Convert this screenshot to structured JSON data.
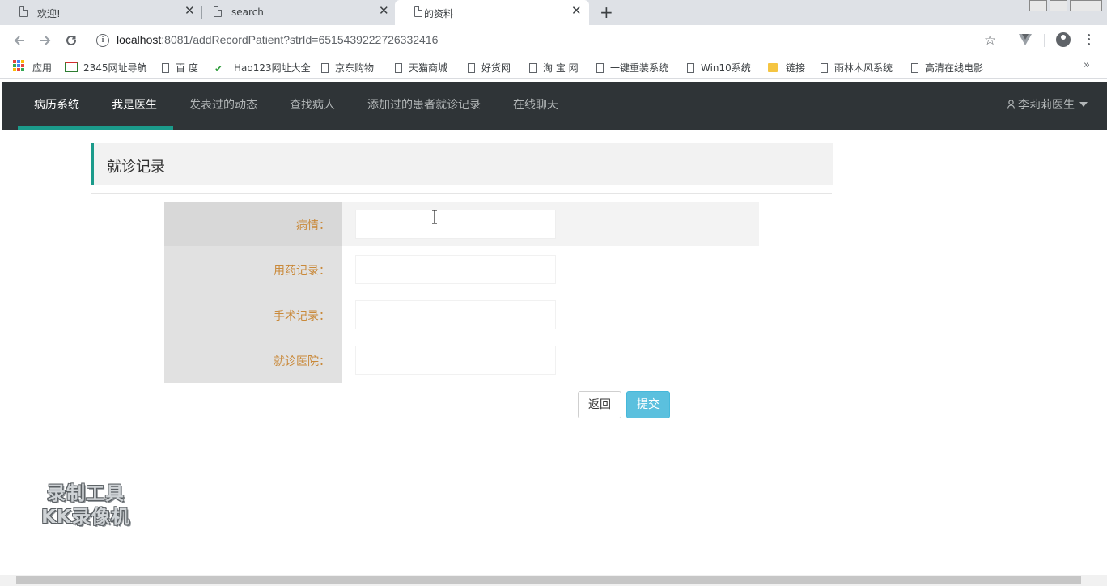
{
  "browser": {
    "tabs": [
      {
        "title": "欢迎!",
        "active": false
      },
      {
        "title": "search",
        "active": false
      },
      {
        "title": "的资料",
        "active": true
      }
    ],
    "url_host": "localhost",
    "url_rest": ":8081/addRecordPatient?strId=6515439222726332416",
    "bookmarks": [
      "应用",
      "2345网址导航",
      "百 度",
      "Hao123网址大全",
      "京东购物",
      "天猫商城",
      "好货网",
      "淘 宝 网",
      "一键重装系统",
      "Win10系统",
      "链接",
      "雨林木风系统",
      "高清在线电影"
    ],
    "bookmarks_more": "»"
  },
  "navbar": {
    "items": [
      "病历系统",
      "我是医生",
      "发表过的动态",
      "查找病人",
      "添加过的患者就诊记录",
      "在线聊天"
    ],
    "user": "李莉莉医生"
  },
  "page": {
    "section_title": "就诊记录",
    "form": {
      "fields": [
        {
          "label": "病情：",
          "value": ""
        },
        {
          "label": "用药记录：",
          "value": ""
        },
        {
          "label": "手术记录：",
          "value": ""
        },
        {
          "label": "就诊医院：",
          "value": ""
        }
      ]
    },
    "buttons": {
      "back": "返回",
      "submit": "提交"
    }
  },
  "watermark": {
    "line1": "录制工具",
    "line2": "KK录像机"
  },
  "colors": {
    "navbar_bg": "#2f3437",
    "accent": "#1b9b8b",
    "label": "#c9893a",
    "submit": "#5bc0de"
  }
}
